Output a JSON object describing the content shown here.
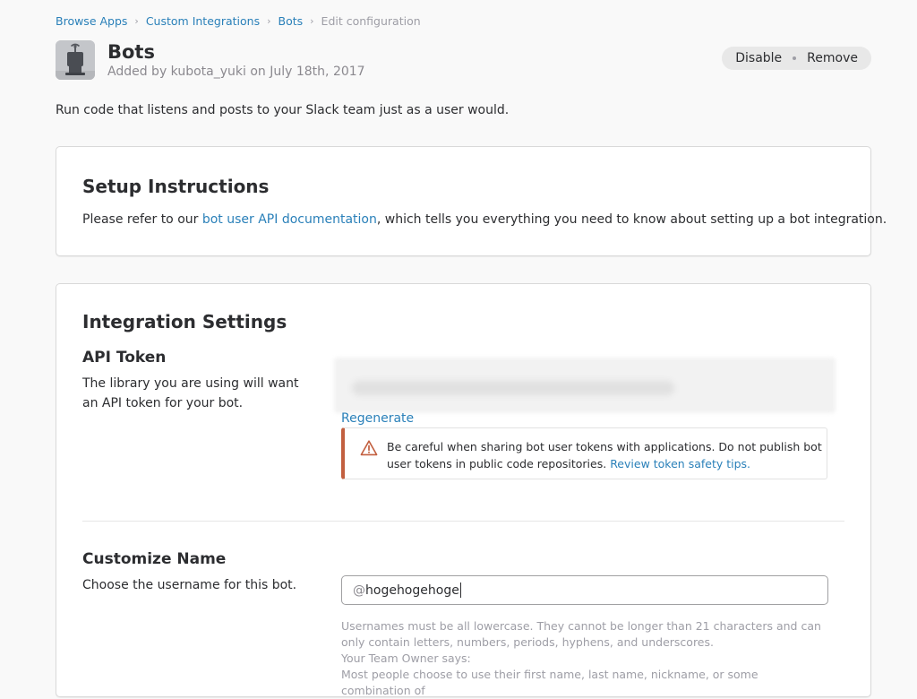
{
  "breadcrumb": {
    "items": [
      "Browse Apps",
      "Custom Integrations",
      "Bots"
    ],
    "current": "Edit configuration",
    "separator": "›"
  },
  "header": {
    "title": "Bots",
    "subtitle": "Added by kubota_yuki on July 18th, 2017",
    "icon": "bot-icon",
    "actions": {
      "disable": "Disable",
      "remove": "Remove"
    }
  },
  "description": "Run code that listens and posts to your Slack team just as a user would.",
  "setup": {
    "title": "Setup Instructions",
    "text_before": "Please refer to our ",
    "link": "bot user API documentation",
    "text_after": ", which tells you everything you need to know about setting up a bot integration."
  },
  "settings": {
    "title": "Integration Settings",
    "api_token": {
      "title": "API Token",
      "description": "The library you are using will want an API token for your bot.",
      "regenerate": "Regenerate",
      "warning": {
        "icon": "warning-triangle-icon",
        "text": "Be careful when sharing bot user tokens with applications. Do not publish bot user tokens in public code repositories. ",
        "link": "Review token safety tips."
      }
    },
    "customize_name": {
      "title": "Customize Name",
      "description": "Choose the username for this bot.",
      "prefix": "@",
      "value": "hogehogehoge",
      "hint_1": "Usernames must be all lowercase. They cannot be longer than 21 characters and can only contain letters, numbers, periods, hyphens, and underscores.",
      "hint_2": "Your Team Owner says:",
      "hint_3": "Most people choose to use their first name, last name, nickname, or some combination of"
    }
  },
  "colors": {
    "link": "#2a80b9",
    "warning_border": "#c25f3f",
    "background": "#f9f9f9"
  }
}
